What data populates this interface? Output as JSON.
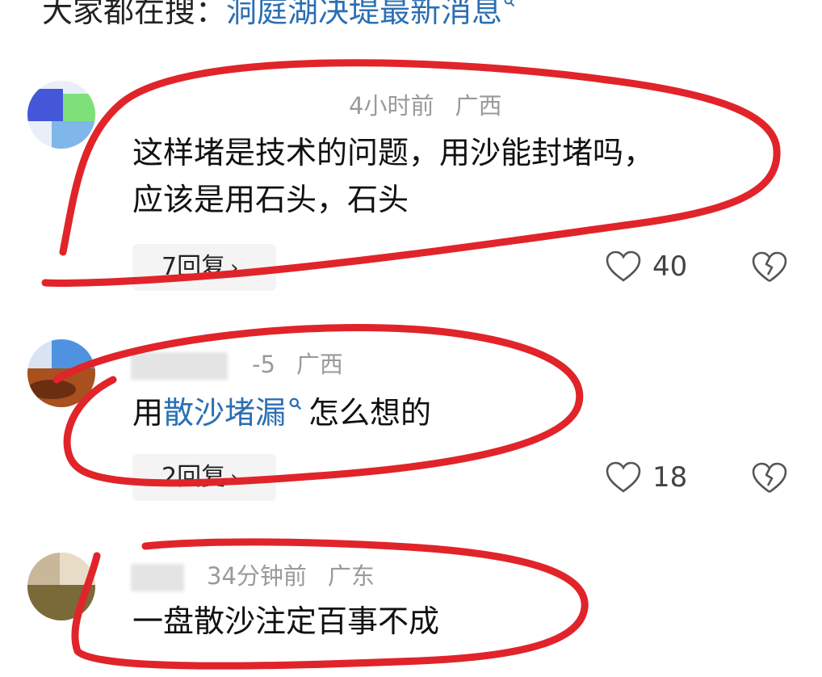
{
  "top_search": {
    "label": "大家都在搜：",
    "query": "洞庭湖决堤最新消息"
  },
  "comments": [
    {
      "time": "4小时前",
      "region": "广西",
      "text_line1": "这样堵是技术的问题，用沙能封堵吗，",
      "text_line2": "应该是用石头，石头",
      "replies": "7回复",
      "likes": "40"
    },
    {
      "time": "-5",
      "region": "广西",
      "text_pre": "用",
      "text_link": "散沙堵漏",
      "text_post": "怎么想的",
      "replies": "2回复",
      "likes": "18"
    },
    {
      "time": "34分钟前",
      "region": "广东",
      "text_line1": "一盘散沙注定百事不成"
    }
  ],
  "colors": {
    "link": "#2b6fb3",
    "annotation_red": "#e0242a",
    "meta_gray": "#9a9a9a"
  }
}
